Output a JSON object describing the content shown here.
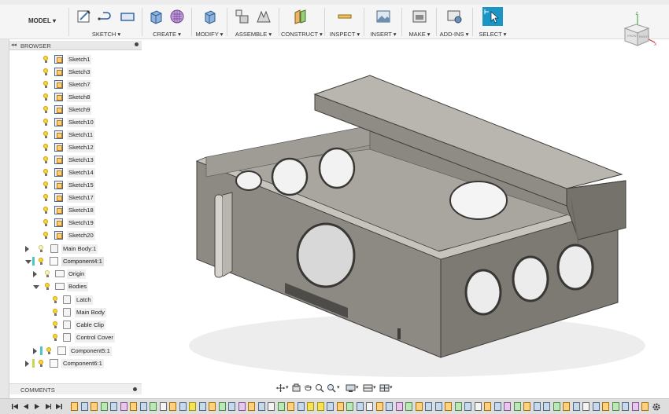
{
  "toolbar": {
    "model_menu": "MODEL ▾",
    "groups": [
      {
        "label": "SKETCH ▾",
        "icons": [
          "create-sketch-icon",
          "line-icon",
          "rectangle-icon"
        ]
      },
      {
        "label": "CREATE ▾",
        "icons": [
          "extrude-icon",
          "pattern-icon"
        ]
      },
      {
        "label": "MODIFY ▾",
        "icons": [
          "press-pull-icon"
        ]
      },
      {
        "label": "ASSEMBLE ▾",
        "icons": [
          "new-component-icon",
          "joint-icon"
        ]
      },
      {
        "label": "CONSTRUCT ▾",
        "icons": [
          "offset-plane-icon"
        ]
      },
      {
        "label": "INSPECT ▾",
        "icons": [
          "measure-icon"
        ]
      },
      {
        "label": "INSERT ▾",
        "icons": [
          "insert-image-icon"
        ]
      },
      {
        "label": "MAKE ▾",
        "icons": [
          "3d-print-icon"
        ]
      },
      {
        "label": "ADD-INS ▾",
        "icons": [
          "scripts-icon"
        ]
      },
      {
        "label": "SELECT ▾",
        "icons": [
          "select-icon"
        ]
      }
    ]
  },
  "browser": {
    "title": "BROWSER",
    "items": [
      {
        "label": "Sketch1",
        "type": "sketch"
      },
      {
        "label": "Sketch3",
        "type": "sketch"
      },
      {
        "label": "Sketch7",
        "type": "sketch"
      },
      {
        "label": "Sketch8",
        "type": "sketch"
      },
      {
        "label": "Sketch9",
        "type": "sketch"
      },
      {
        "label": "Sketch10",
        "type": "sketch"
      },
      {
        "label": "Sketch11",
        "type": "sketch"
      },
      {
        "label": "Sketch12",
        "type": "sketch"
      },
      {
        "label": "Sketch13",
        "type": "sketch"
      },
      {
        "label": "Sketch14",
        "type": "sketch"
      },
      {
        "label": "Sketch15",
        "type": "sketch"
      },
      {
        "label": "Sketch17",
        "type": "sketch"
      },
      {
        "label": "Sketch18",
        "type": "sketch"
      },
      {
        "label": "Sketch19",
        "type": "sketch"
      },
      {
        "label": "Sketch20",
        "type": "sketch"
      },
      {
        "label": "Main Body:1",
        "type": "component"
      },
      {
        "label": "Component4:1",
        "type": "component"
      },
      {
        "label": "Origin",
        "type": "folder"
      },
      {
        "label": "Bodies",
        "type": "folder"
      },
      {
        "label": "Latch",
        "type": "body"
      },
      {
        "label": "Main Body",
        "type": "body"
      },
      {
        "label": "Cable Clip",
        "type": "body"
      },
      {
        "label": "Control Cover",
        "type": "body"
      },
      {
        "label": "Component5:1",
        "type": "component"
      },
      {
        "label": "Component6:1",
        "type": "component"
      }
    ]
  },
  "comments": {
    "title": "COMMENTS"
  },
  "viewcube": {
    "front_label": "FRONT",
    "right_label": "RIGHT",
    "z_label": "Z",
    "x_label": "X"
  },
  "colors": {
    "accent_teal": "#4fc5c8",
    "accent_olive": "#c7d655",
    "select_blue": "#1b95c4",
    "model_gray": "#8a8780"
  }
}
